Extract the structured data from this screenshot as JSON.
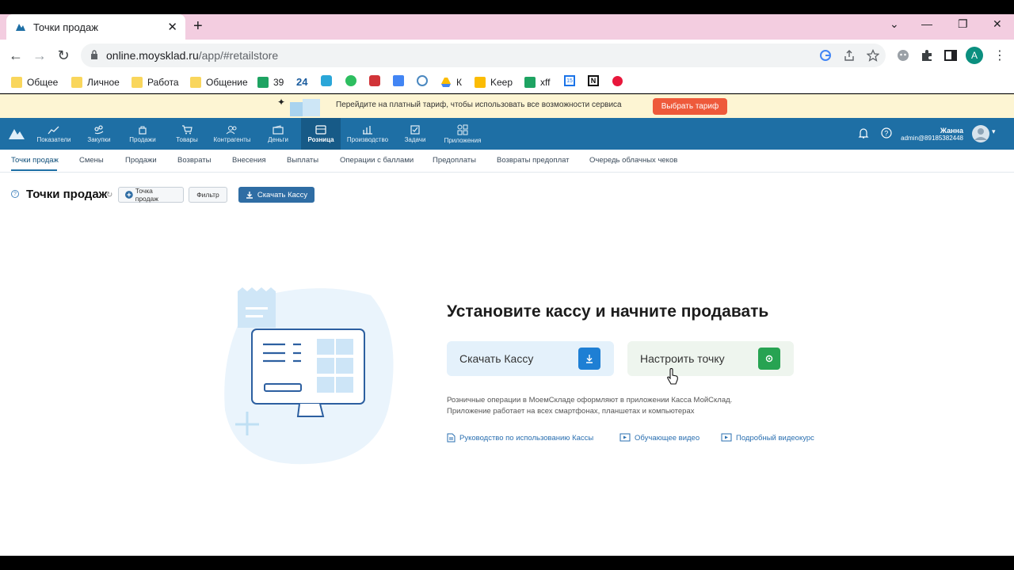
{
  "browser": {
    "tab_title": "Точки продаж",
    "url_host": "online.moysklad.ru",
    "url_path": "/app/#retailstore",
    "avatar_letter": "A"
  },
  "bookmarks": [
    {
      "label": "Общее",
      "icon": "folder-icon"
    },
    {
      "label": "Личное",
      "icon": "folder-icon"
    },
    {
      "label": "Работа",
      "icon": "folder-icon"
    },
    {
      "label": "Общение",
      "icon": "folder-icon"
    },
    {
      "label": "39",
      "icon": "sheets-icon"
    },
    {
      "label": "24",
      "icon": "bitrix-icon"
    },
    {
      "label": "К",
      "icon": "drive-icon"
    },
    {
      "label": "Keep",
      "icon": "keep-icon"
    },
    {
      "label": "xff",
      "icon": "sheets-icon"
    }
  ],
  "promo": {
    "text": "Перейдите на платный тариф, чтобы использовать все возможности сервиса",
    "button": "Выбрать тариф"
  },
  "appnav": [
    {
      "label": "Показатели"
    },
    {
      "label": "Закупки"
    },
    {
      "label": "Продажи"
    },
    {
      "label": "Товары"
    },
    {
      "label": "Контрагенты"
    },
    {
      "label": "Деньги"
    },
    {
      "label": "Розница"
    },
    {
      "label": "Производство"
    },
    {
      "label": "Задачи"
    },
    {
      "label": "Приложения"
    }
  ],
  "user": {
    "name": "Жанна",
    "login": "admin@89185382448"
  },
  "subnav": [
    "Точки продаж",
    "Смены",
    "Продажи",
    "Возвраты",
    "Внесения",
    "Выплаты",
    "Операции с баллами",
    "Предоплаты",
    "Возвраты предоплат",
    "Очередь облачных чеков"
  ],
  "page": {
    "title": "Точки продаж",
    "add_button": "Точка продаж",
    "filter_button": "Фильтр",
    "download_button": "Скачать Кассу"
  },
  "hero": {
    "title": "Установите кассу и начните продавать",
    "card_download": "Скачать Кассу",
    "card_setup": "Настроить точку",
    "desc_line1": "Розничные операции в МоемСкладе оформляют в приложении Касса МойСклад.",
    "desc_line2": "Приложение работает на всех смартфонах, планшетах и компьютерах",
    "link_manual": "Руководство по использованию Кассы",
    "link_video": "Обучающее видео",
    "link_course": "Подробный видеокурс"
  },
  "colors": {
    "app_nav": "#1e6fa5",
    "promo_button": "#ee5a3b",
    "download_icon_bg": "#1e7fd4",
    "setup_icon_bg": "#27a352"
  }
}
